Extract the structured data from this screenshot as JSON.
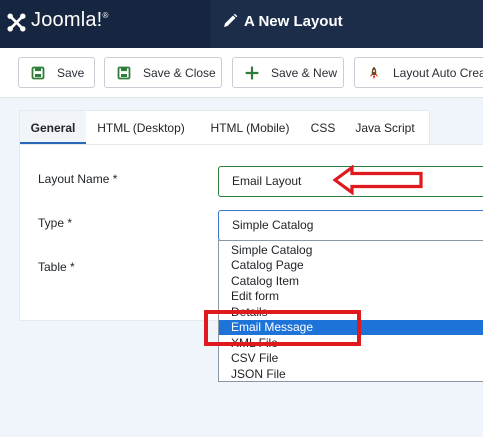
{
  "header": {
    "brand_name": "Joomla!",
    "page_title": "A New Layout"
  },
  "toolbar": {
    "save_label": "Save",
    "save_close_label": "Save & Close",
    "save_new_label": "Save & New",
    "layout_auto_label": "Layout Auto Crea"
  },
  "tabs": [
    {
      "label": "General",
      "active": true
    },
    {
      "label": "HTML (Desktop)",
      "active": false
    },
    {
      "label": "HTML (Mobile)",
      "active": false
    },
    {
      "label": "CSS",
      "active": false
    },
    {
      "label": "Java Script",
      "active": false
    }
  ],
  "form": {
    "layout_name_label": "Layout Name *",
    "layout_name_value": "Email Layout",
    "type_label": "Type *",
    "type_value": "Simple Catalog",
    "table_label": "Table *"
  },
  "type_options": [
    {
      "label": "Simple Catalog",
      "selected": false
    },
    {
      "label": "Catalog Page",
      "selected": false
    },
    {
      "label": "Catalog Item",
      "selected": false
    },
    {
      "label": "Edit form",
      "selected": false
    },
    {
      "label": "Details",
      "selected": false
    },
    {
      "label": "Email Message",
      "selected": true
    },
    {
      "label": "XML File",
      "selected": false
    },
    {
      "label": "CSV File",
      "selected": false
    },
    {
      "label": "JSON File",
      "selected": false
    }
  ],
  "icons": {
    "brand": "joomla-logo-icon",
    "title": "pencil-icon",
    "save": "save-icon",
    "save_close": "save-icon",
    "save_new": "plus-icon",
    "layout_auto": "rocket-icon"
  },
  "colors": {
    "header_bg": "#1c2d4a",
    "brand_bg": "#172640",
    "toolbar_green": "#2e7d3a",
    "tab_accent": "#2a69b8",
    "selected_option": "#1e73d8",
    "annotation_red": "#e0191f"
  }
}
